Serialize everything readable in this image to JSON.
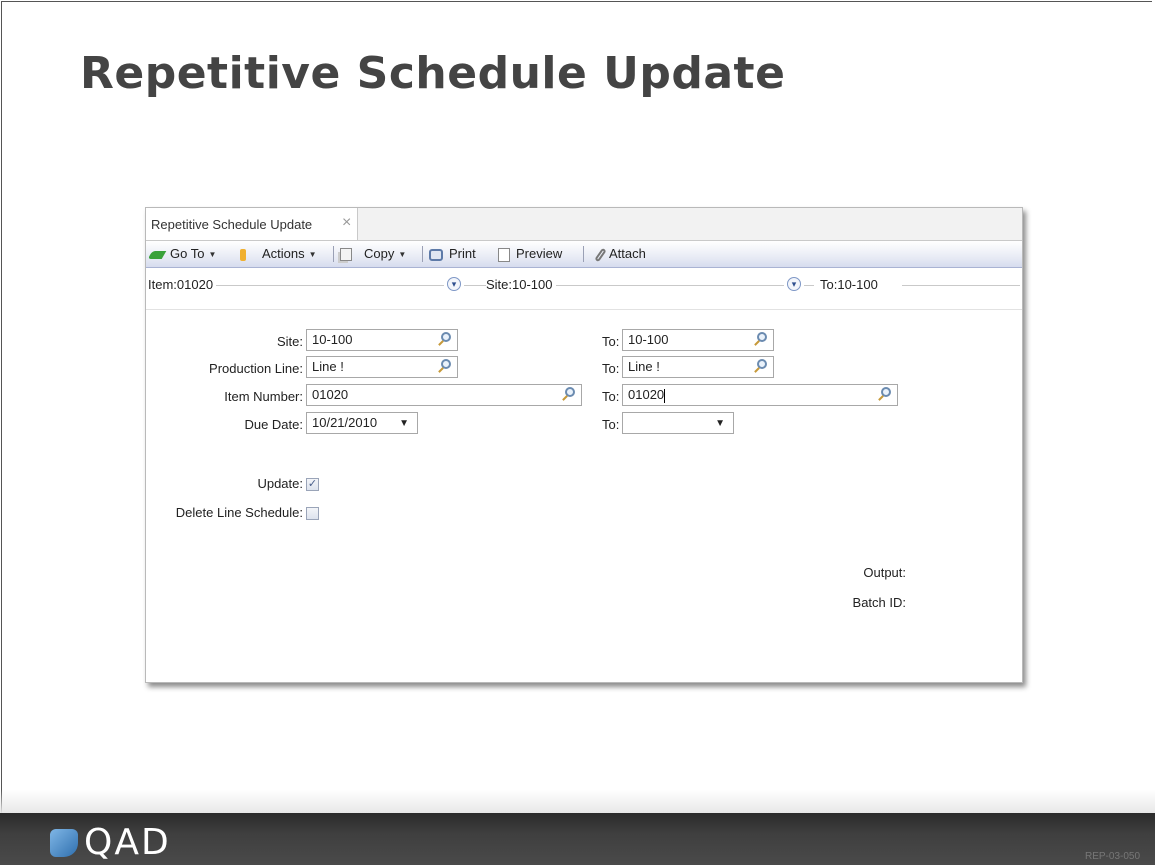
{
  "slide": {
    "title": "Repetitive Schedule Update",
    "doc_code": "REP-03-050",
    "logo_text": "QAD"
  },
  "window": {
    "tab_label": "Repetitive Schedule Update",
    "toolbar": {
      "goto_label": "Go To",
      "actions_label": "Actions",
      "copy_label": "Copy",
      "print_label": "Print",
      "preview_label": "Preview",
      "attach_label": "Attach"
    },
    "summary": {
      "item": "Item:01020",
      "site": "Site:10-100",
      "to": "To:10-100"
    },
    "form": {
      "site_label": "Site:",
      "site_value": "10-100",
      "site_to_label": "To:",
      "site_to_value": "10-100",
      "prod_line_label": "Production Line:",
      "prod_line_value": "Line !",
      "prod_line_to_label": "To:",
      "prod_line_to_value": "Line !",
      "item_label": "Item Number:",
      "item_value": "01020",
      "item_to_label": "To:",
      "item_to_value": "01020",
      "due_label": "Due Date:",
      "due_value": "10/21/2010",
      "due_to_label": "To:",
      "due_to_value": "",
      "update_label": "Update:",
      "update_checked": true,
      "delete_label": "Delete Line Schedule:",
      "delete_checked": false,
      "output_label": "Output:",
      "batch_label": "Batch ID:"
    }
  }
}
